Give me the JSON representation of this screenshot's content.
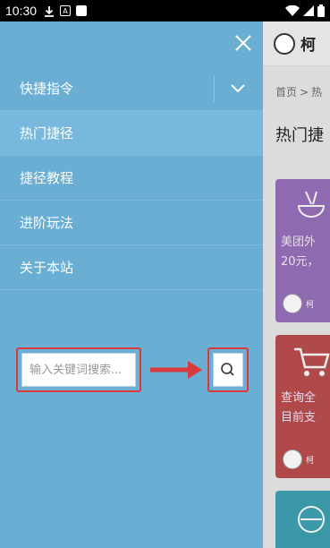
{
  "status_bar": {
    "time": "10:30"
  },
  "drawer": {
    "nav": [
      {
        "label": "快捷指令"
      },
      {
        "label": "热门捷径"
      },
      {
        "label": "捷径教程"
      },
      {
        "label": "进阶玩法"
      },
      {
        "label": "关于本站"
      }
    ],
    "search": {
      "placeholder": "输入关键词搜索..."
    }
  },
  "page": {
    "brand": "柯",
    "breadcrumb": {
      "home": "首页",
      "sep": ">",
      "current": "热"
    },
    "title": "热门捷",
    "cards": [
      {
        "text1": "美团外",
        "text2": "20元，",
        "author": "柯"
      },
      {
        "text1": "查询全",
        "text2": "目前支",
        "author": "柯"
      },
      {
        "text1": "",
        "text2": "",
        "author": ""
      }
    ]
  },
  "colors": {
    "drawer": "#6aaed4",
    "highlight": "#d93a3a",
    "card1": "#8e6ab0",
    "card2": "#b04a4a",
    "card3": "#3a98a8"
  }
}
